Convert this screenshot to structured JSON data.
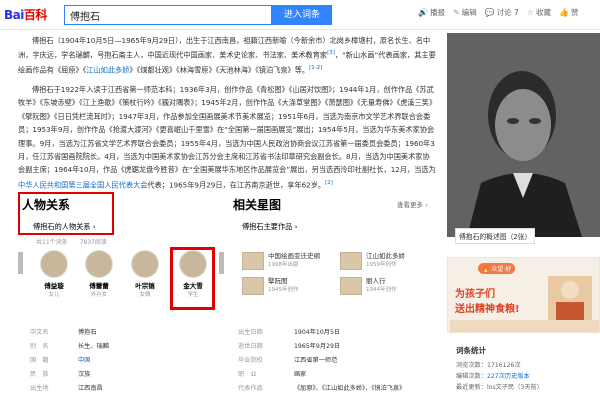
{
  "header": {
    "logo_text": "Bai",
    "logo_suffix": "百科",
    "search_value": "傅抱石",
    "search_button": "进入词条",
    "actions": [
      "播报",
      "编辑",
      "讨论 7",
      "收藏",
      "赞"
    ]
  },
  "article": {
    "p1": "傅抱石（1904年10月5日—1965年9月29日），出生于江西南昌，祖籍江西新喻（今新余市）北岗乡樟塘村，原名长生、名中洲，字庆远，学名瑞麟，号抱石斋主人，中国近现代中国画家、美术史论家、书法家、美术教育家",
    "p1_sup1": "[3]",
    "p1_b": "，“新山水画”代表画家，其主要绘画作品有《屈原》《",
    "p1_link1": "江山如此多娇",
    "p1_c": "》《煤都壮观》《林海雪原》《天池林海》《镜泊飞泉》等。",
    "p1_sup2": "[1-2]",
    "p2": "傅抱石于1922年入读于江西省第一师范本科；1936年3月，创作作品《青松图》《山居对饮图》；1944年1月，创作作品《苏武牧羊》《东坡赤壁》《江上渔歌》《策杖行吟》《巍对隅表》；1945年2月，创作作品《大涤草堂图》《萧瑟图》《无量寿佛》《虎溪三笑》《擘阮图》《日日凭栏流耳时》；1947年3月，作品参加全国画展美术节美术展览；1951年6月，当选为南京市文学艺术界联合会委员；1953年9月，创作作品《抢渡大渡河》《更喜岷山千里雪》在“全国第一届国画展览”展出；1954年5月，当选为华东美术家协会理事。9月，当选为江苏省文学艺术界联合会委员；1955年4月，当选为中国人民政治协商会议江苏省第一届委员会委员；1960年3月，任江苏省国画院院长。4月，当选为中国美术家协会江苏分会主席和江苏省书法印章研究会副会长。8月，当选为中国美术家协会副主席；1964年10月，作品《虎踞龙盘今胜昔》在“全国美展华东地区作品展览会”展出，另当选西泠印社副社长，12月，当选为",
    "p2_link": "中华人民共和国第三届全国人民代表大会",
    "p2_end": "代表；1965年9月29日，在江苏南京逝世，享年62岁。",
    "p2_sup": "[2]"
  },
  "relations": {
    "title": "人物关系",
    "subtitle": "傅抱石的人物关系 ›",
    "meta_total": "共11个词条",
    "meta_views": "7837阅读",
    "people": [
      {
        "name": "傅益璇",
        "role": "女儿"
      },
      {
        "name": "傅蕾蕾",
        "role": "外孙女"
      },
      {
        "name": "叶宗镐",
        "role": "女婿"
      },
      {
        "name": "金大雪",
        "role": "学生"
      }
    ]
  },
  "stars": {
    "title": "相关星图",
    "more": "查看更多 ›",
    "works_head": "傅抱石主要作品 ›",
    "works": [
      {
        "title": "中国绘画变迁史纲",
        "year": "1998年出版"
      },
      {
        "title": "江山如此多娇",
        "year": "1959年创作"
      },
      {
        "title": "擘阮图",
        "year": "1945年创作"
      },
      {
        "title": "丽人行",
        "year": "1944年创作"
      }
    ]
  },
  "info": {
    "rows": [
      {
        "k1": "中文名",
        "v1": "傅抱石",
        "k2": "出生日期",
        "v2": "1904年10月5日"
      },
      {
        "k1": "别　名",
        "v1": "长生、瑞麟",
        "k2": "逝世日期",
        "v2": "1965年9月29日"
      },
      {
        "k1": "国　籍",
        "v1": "中国",
        "k2": "毕业院校",
        "v2": "江西省第一师范"
      },
      {
        "k1": "民　族",
        "v1": "汉族",
        "k2": "职　业",
        "v2": "画家"
      },
      {
        "k1": "出生地",
        "v1": "江西南昌",
        "k2": "代表作品",
        "v2": "《屈原》、《江山如此多娇》、《镜泊飞泉》"
      }
    ]
  },
  "sidebar": {
    "portrait_caption": "傅抱石的概述图（2张）",
    "ad_brand": "🔥 众望·好",
    "ad_line1": "为孩子们",
    "ad_line2": "送出精神食粮!",
    "stats_title": "词条统计",
    "stats": [
      {
        "k": "浏览次数：",
        "v": "1716126次"
      },
      {
        "k": "编辑次数：",
        "v": "227次历史版本"
      },
      {
        "k": "最近更新：",
        "v": "los文子民（3天前）"
      }
    ]
  }
}
